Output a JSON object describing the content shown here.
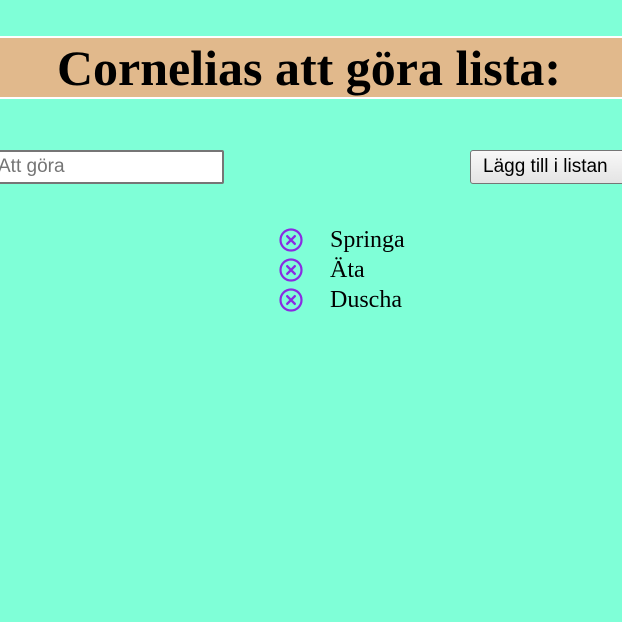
{
  "header": {
    "title": "Cornelias att göra lista:"
  },
  "form": {
    "input_placeholder": "Att göra",
    "input_value": "",
    "add_button_label": "Lägg till i listan"
  },
  "todos": {
    "items": [
      {
        "text": "Springa",
        "remove_icon": "close-circle-icon"
      },
      {
        "text": "Äta",
        "remove_icon": "close-circle-icon"
      },
      {
        "text": "Duscha",
        "remove_icon": "close-circle-icon"
      }
    ]
  },
  "colors": {
    "background": "#7fffd7",
    "header_background": "#e1b98c",
    "remove_icon": "#8a2be2"
  }
}
